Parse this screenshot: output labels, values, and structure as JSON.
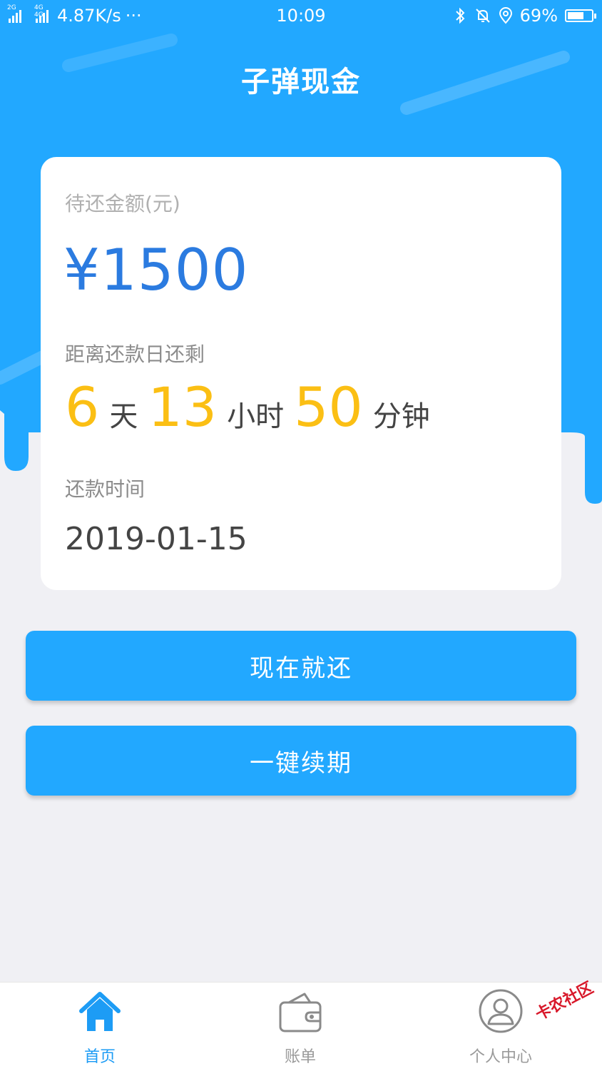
{
  "status_bar": {
    "network_1": "2G",
    "network_2": "4G 4G",
    "speed": "4.87K/s",
    "more": "···",
    "time": "10:09",
    "battery": "69%",
    "battery_level_percent": 69,
    "icons": [
      "bluetooth-icon",
      "mute-bell-icon",
      "location-icon",
      "battery-icon"
    ]
  },
  "header": {
    "title": "子弹现金"
  },
  "card": {
    "amount_label": "待还金额(元)",
    "amount": "¥1500",
    "remain_label": "距离还款日还剩",
    "days": "6",
    "days_unit": "天",
    "hours": "13",
    "hours_unit": "小时",
    "minutes": "50",
    "minutes_unit": "分钟",
    "date_label": "还款时间",
    "date": "2019-01-15"
  },
  "buttons": {
    "repay": "现在就还",
    "extend": "一键续期"
  },
  "tabbar": {
    "home": "首页",
    "bill": "账单",
    "user": "个人中心",
    "active": "home"
  },
  "watermark": {
    "text": "卡农社区"
  },
  "colors": {
    "primary": "#22a8ff",
    "amount": "#2b7be0",
    "countdown": "#fbbf14",
    "background": "#f0f0f4"
  }
}
